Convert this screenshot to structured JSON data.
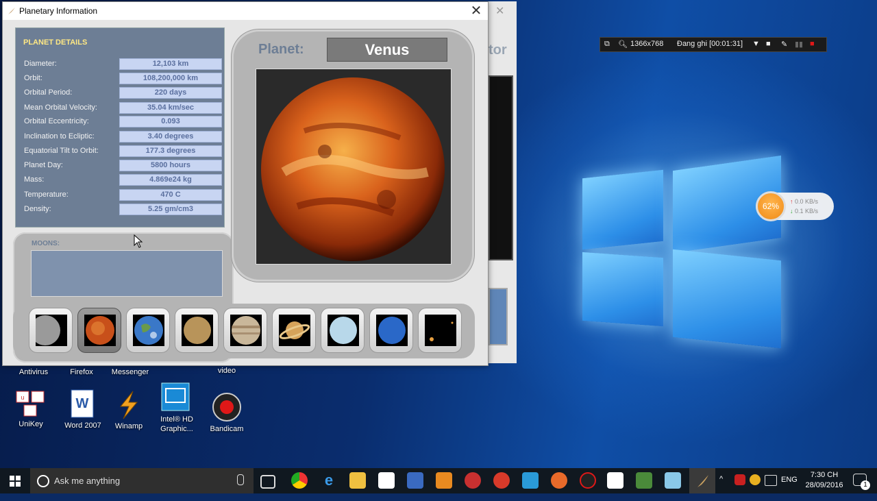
{
  "window": {
    "title": "Planetary Information",
    "close_glyph": "✕"
  },
  "back_window": {
    "partial_title": "tor",
    "close_glyph": "✕"
  },
  "details": {
    "header": "PLANET DETAILS",
    "rows": [
      {
        "label": "Diameter:",
        "value": "12,103 km"
      },
      {
        "label": "Orbit:",
        "value": "108,200,000 km"
      },
      {
        "label": "Orbital Period:",
        "value": "220 days"
      },
      {
        "label": "Mean Orbital Velocity:",
        "value": "35.04 km/sec"
      },
      {
        "label": "Orbital  Eccentricity:",
        "value": "0.093"
      },
      {
        "label": "Inclination to Ecliptic:",
        "value": "3.40 degrees"
      },
      {
        "label": "Equatorial Tilt to Orbit:",
        "value": "177.3 degrees"
      },
      {
        "label": "Planet Day:",
        "value": "5800 hours"
      },
      {
        "label": "Mass:",
        "value": "4.869e24 kg"
      },
      {
        "label": "Temperature:",
        "value": "470 C"
      },
      {
        "label": "Density:",
        "value": "5.25 gm/cm3"
      }
    ]
  },
  "moons": {
    "header": "MOONS:"
  },
  "planet": {
    "label": "Planet:",
    "name": "Venus"
  },
  "thumbnails": [
    {
      "name": "mercury",
      "color": "#9a9a9a"
    },
    {
      "name": "venus",
      "color": "#c8501a",
      "selected": true
    },
    {
      "name": "earth",
      "color": "#3a78c8"
    },
    {
      "name": "mars",
      "color": "#b8945a"
    },
    {
      "name": "jupiter",
      "color": "#c9b79a"
    },
    {
      "name": "saturn",
      "color": "#d6a35a"
    },
    {
      "name": "uranus",
      "color": "#b8d8ea"
    },
    {
      "name": "neptune",
      "color": "#2a68c8"
    },
    {
      "name": "pluto",
      "color": "#000000"
    }
  ],
  "desktop": {
    "top_labels": [
      "Antivirus",
      "Firefox",
      "Messenger",
      "video"
    ],
    "icons": [
      {
        "label": "UniKey"
      },
      {
        "label": "Word 2007"
      },
      {
        "label": "Winamp"
      },
      {
        "label": "Intel® HD Graphic..."
      },
      {
        "label": "Bandicam"
      }
    ]
  },
  "bandicam": {
    "resolution": "1366x768",
    "recording": "Đang ghi [00:01:31]"
  },
  "network": {
    "percent": "62%",
    "up": "0.0 KB/s",
    "down": "0.1 KB/s"
  },
  "taskbar": {
    "search_placeholder": "Ask me anything",
    "tray_lang": "ENG",
    "time": "7:30 CH",
    "date": "28/09/2016",
    "notification_count": "1"
  }
}
